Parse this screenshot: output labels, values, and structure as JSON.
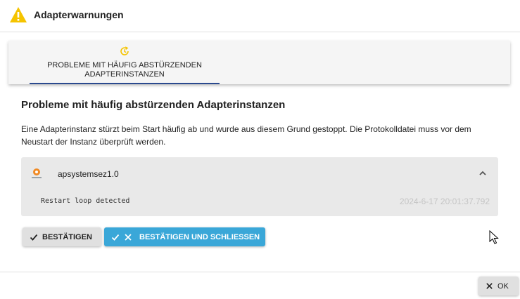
{
  "dialog": {
    "title": "Adapterwarnungen",
    "warning_color": "#f5c400"
  },
  "tabs": [
    {
      "label": "PROBLEME MIT HÄUFIG ABSTÜRZENDEN ADAPTERINSTANZEN",
      "icon": "restart-icon",
      "selected": true
    }
  ],
  "content": {
    "heading": "Probleme mit häufig abstürzenden Adapterinstanzen",
    "description": "Eine Adapterinstanz stürzt beim Start häufig ab und wurde aus diesem Grund gestoppt. Die Protokolldatei muss vor dem Neustart der Instanz überprüft werden."
  },
  "panel": {
    "adapter_name": "apsystemsez1.0",
    "expanded": true,
    "log_message": "Restart loop detected",
    "log_timestamp": "2024-6-17 20:01:37.792"
  },
  "actions": {
    "confirm_label": "BESTÄTIGEN",
    "confirm_close_label": "BESTÄTIGEN UND SCHLIESSEN",
    "accent_color": "#3aa7d8"
  },
  "footer": {
    "ok_label": "OK"
  }
}
